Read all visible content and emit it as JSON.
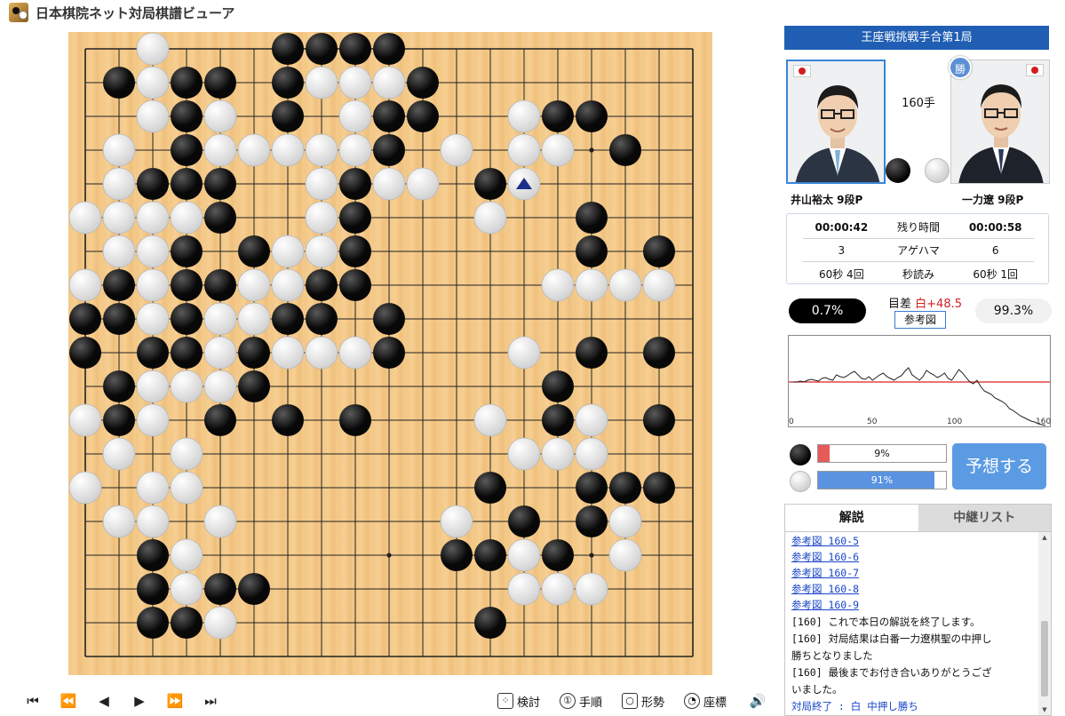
{
  "app": {
    "title": "日本棋院ネット対局棋譜ビューア"
  },
  "board": {
    "size": 19,
    "black": [
      [
        6,
        0
      ],
      [
        7,
        0
      ],
      [
        8,
        0
      ],
      [
        9,
        0
      ],
      [
        1,
        1
      ],
      [
        3,
        1
      ],
      [
        4,
        1
      ],
      [
        6,
        1
      ],
      [
        10,
        1
      ],
      [
        3,
        2
      ],
      [
        6,
        2
      ],
      [
        9,
        2
      ],
      [
        10,
        2
      ],
      [
        14,
        2
      ],
      [
        15,
        2
      ],
      [
        3,
        3
      ],
      [
        9,
        3
      ],
      [
        16,
        3
      ],
      [
        2,
        4
      ],
      [
        3,
        4
      ],
      [
        4,
        4
      ],
      [
        8,
        4
      ],
      [
        12,
        4
      ],
      [
        4,
        5
      ],
      [
        8,
        5
      ],
      [
        15,
        5
      ],
      [
        3,
        6
      ],
      [
        5,
        6
      ],
      [
        8,
        6
      ],
      [
        15,
        6
      ],
      [
        17,
        6
      ],
      [
        1,
        7
      ],
      [
        3,
        7
      ],
      [
        4,
        7
      ],
      [
        7,
        7
      ],
      [
        8,
        7
      ],
      [
        0,
        8
      ],
      [
        1,
        8
      ],
      [
        3,
        8
      ],
      [
        6,
        8
      ],
      [
        7,
        8
      ],
      [
        9,
        8
      ],
      [
        0,
        9
      ],
      [
        2,
        9
      ],
      [
        3,
        9
      ],
      [
        5,
        9
      ],
      [
        9,
        9
      ],
      [
        15,
        9
      ],
      [
        17,
        9
      ],
      [
        1,
        10
      ],
      [
        5,
        10
      ],
      [
        14,
        10
      ],
      [
        1,
        11
      ],
      [
        4,
        11
      ],
      [
        6,
        11
      ],
      [
        8,
        11
      ],
      [
        14,
        11
      ],
      [
        17,
        11
      ],
      [
        12,
        13
      ],
      [
        15,
        13
      ],
      [
        16,
        13
      ],
      [
        17,
        13
      ],
      [
        13,
        14
      ],
      [
        15,
        14
      ],
      [
        2,
        15
      ],
      [
        11,
        15
      ],
      [
        12,
        15
      ],
      [
        14,
        15
      ],
      [
        2,
        16
      ],
      [
        4,
        16
      ],
      [
        5,
        16
      ],
      [
        2,
        17
      ],
      [
        3,
        17
      ],
      [
        12,
        17
      ]
    ],
    "white": [
      [
        2,
        0
      ],
      [
        2,
        1
      ],
      [
        7,
        1
      ],
      [
        8,
        1
      ],
      [
        9,
        1
      ],
      [
        2,
        2
      ],
      [
        4,
        2
      ],
      [
        8,
        2
      ],
      [
        13,
        2
      ],
      [
        1,
        3
      ],
      [
        4,
        3
      ],
      [
        5,
        3
      ],
      [
        6,
        3
      ],
      [
        7,
        3
      ],
      [
        8,
        3
      ],
      [
        11,
        3
      ],
      [
        13,
        3
      ],
      [
        14,
        3
      ],
      [
        1,
        4
      ],
      [
        7,
        4
      ],
      [
        9,
        4
      ],
      [
        10,
        4
      ],
      [
        13,
        4
      ],
      [
        0,
        5
      ],
      [
        1,
        5
      ],
      [
        2,
        5
      ],
      [
        3,
        5
      ],
      [
        7,
        5
      ],
      [
        12,
        5
      ],
      [
        1,
        6
      ],
      [
        2,
        6
      ],
      [
        6,
        6
      ],
      [
        7,
        6
      ],
      [
        0,
        7
      ],
      [
        2,
        7
      ],
      [
        5,
        7
      ],
      [
        6,
        7
      ],
      [
        14,
        7
      ],
      [
        15,
        7
      ],
      [
        16,
        7
      ],
      [
        17,
        7
      ],
      [
        2,
        8
      ],
      [
        4,
        8
      ],
      [
        5,
        8
      ],
      [
        4,
        9
      ],
      [
        6,
        9
      ],
      [
        7,
        9
      ],
      [
        8,
        9
      ],
      [
        13,
        9
      ],
      [
        2,
        10
      ],
      [
        3,
        10
      ],
      [
        4,
        10
      ],
      [
        0,
        11
      ],
      [
        2,
        11
      ],
      [
        12,
        11
      ],
      [
        15,
        11
      ],
      [
        1,
        12
      ],
      [
        3,
        12
      ],
      [
        13,
        12
      ],
      [
        14,
        12
      ],
      [
        15,
        12
      ],
      [
        0,
        13
      ],
      [
        2,
        13
      ],
      [
        3,
        13
      ],
      [
        1,
        14
      ],
      [
        2,
        14
      ],
      [
        4,
        14
      ],
      [
        11,
        14
      ],
      [
        16,
        14
      ],
      [
        3,
        15
      ],
      [
        13,
        15
      ],
      [
        16,
        15
      ],
      [
        3,
        16
      ],
      [
        13,
        16
      ],
      [
        14,
        16
      ],
      [
        15,
        16
      ],
      [
        4,
        17
      ]
    ],
    "last_move": [
      13,
      4
    ]
  },
  "controls": {
    "nav": [
      "⏮",
      "⏪",
      "◀",
      "▶",
      "⏩",
      "⏭"
    ],
    "tools": [
      "検討",
      "手順",
      "形勢",
      "座標"
    ],
    "tool_icons": [
      "grid-icon",
      "order-icon",
      "magnifier-icon",
      "coordinate-icon"
    ],
    "speaker": "🔊"
  },
  "panel": {
    "match_title": "王座戦挑戦手合第1局",
    "move_count": "160手",
    "win_badge": "勝",
    "black_player": {
      "name": "井山裕太 9段P",
      "time": "00:00:42",
      "captures": "3",
      "byoyomi": "60秒 4回"
    },
    "white_player": {
      "name": "一力遼 9段P",
      "time": "00:00:58",
      "captures": "6",
      "byoyomi": "60秒 1回"
    },
    "stat_labels": {
      "time": "残り時間",
      "captures": "アゲハマ",
      "byoyomi": "秒読み"
    },
    "black_winrate": "0.7%",
    "white_winrate": "99.3%",
    "margin_label": "目差",
    "margin_value": "白+48.5",
    "ref_button": "参考図",
    "graph_ticks": [
      "0",
      "50",
      "100",
      "160"
    ],
    "prediction": {
      "black_label": "9%",
      "white_label": "91%",
      "black_fraction": 0.09,
      "white_fraction": 0.91,
      "button": "予想する"
    },
    "tabs": [
      "解説",
      "中継リスト"
    ],
    "commentary": [
      "参考図 160-5",
      "参考図 160-6",
      "参考図 160-7",
      "参考図 160-8",
      "参考図 160-9",
      "[160] これで本日の解説を終了します。",
      "[160] 対局結果は白番一力遼棋聖の中押し",
      "勝ちとなりました",
      "[160] 最後までお付き合いありがとうござ",
      "いました。",
      "対局終了 : 白 中押し勝ち"
    ]
  },
  "colors": {
    "accent": "#1f5eb3",
    "button": "#5b9be3",
    "black_bar": "#e85a5a",
    "white_bar": "#5a93e0",
    "graph_line": "#d92020"
  },
  "winrate_series": [
    50,
    50,
    51,
    50,
    52,
    53,
    52,
    51,
    54,
    55,
    53,
    52,
    58,
    56,
    55,
    57,
    60,
    62,
    58,
    54,
    53,
    56,
    52,
    55,
    58,
    60,
    56,
    54,
    52,
    55,
    57,
    62,
    66,
    58,
    55,
    52,
    56,
    63,
    60,
    58,
    55,
    57,
    60,
    54,
    52,
    58,
    64,
    60,
    55,
    50,
    48,
    52,
    45,
    40,
    38,
    36,
    32,
    30,
    28,
    25,
    20,
    18,
    15,
    12,
    10,
    8,
    6,
    5,
    3,
    2,
    1
  ]
}
